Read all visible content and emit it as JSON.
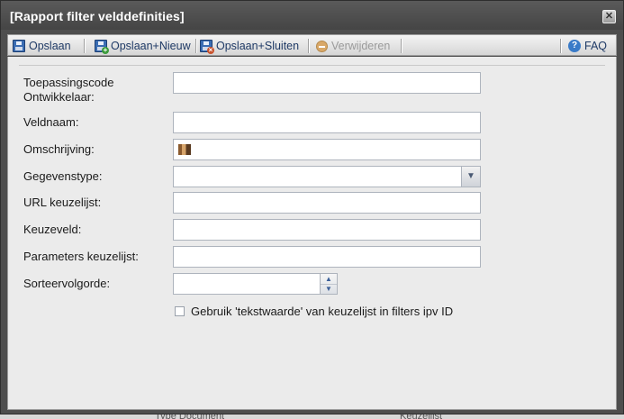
{
  "window": {
    "title": "[Rapport filter velddefinities]"
  },
  "toolbar": {
    "buttons": [
      {
        "label": "Opslaan",
        "icon": "save-icon"
      },
      {
        "label": "Opslaan+Nieuw",
        "icon": "save-new-icon"
      },
      {
        "label": "Opslaan+Sluiten",
        "icon": "save-close-icon"
      },
      {
        "label": "Verwijderen",
        "icon": "delete-icon",
        "disabled": true
      },
      {
        "label": "FAQ",
        "icon": "help-icon"
      }
    ]
  },
  "form": {
    "fields": [
      {
        "label_line1": "Toepassingscode",
        "label_line2": "Ontwikkelaar:",
        "value": ""
      },
      {
        "label": "Veldnaam:",
        "value": ""
      },
      {
        "label": "Omschrijving:",
        "value": ""
      },
      {
        "label": "Gegevenstype:",
        "value": ""
      },
      {
        "label": "URL keuzelijst:",
        "value": ""
      },
      {
        "label": "Keuzeveld:",
        "value": ""
      },
      {
        "label": "Parameters keuzelijst:",
        "value": ""
      },
      {
        "label": "Sorteervolgorde:",
        "value": ""
      }
    ],
    "checkbox": {
      "label": "Gebruik 'tekstwaarde' van keuzelijst in filters ipv ID",
      "checked": false
    }
  },
  "background": {
    "partial_text_left": "Type Document",
    "partial_text_right": "Keuzelijst"
  }
}
